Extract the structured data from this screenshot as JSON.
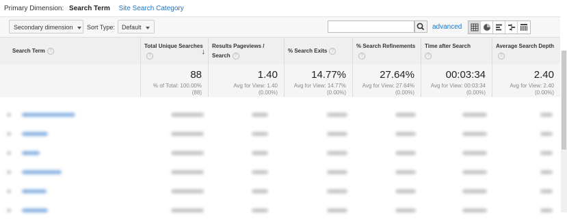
{
  "primary_dimension": {
    "label": "Primary Dimension:",
    "selected": "Search Term",
    "other": "Site Search Category"
  },
  "toolbar": {
    "secondary_dimension": "Secondary dimension",
    "sort_type_label": "Sort Type:",
    "sort_type_value": "Default",
    "search_value": "",
    "advanced": "advanced",
    "view_icons": [
      "table-view-icon",
      "pie-view-icon",
      "bar-view-icon",
      "comparison-view-icon",
      "pivot-view-icon"
    ]
  },
  "columns": [
    {
      "label": "Search Term"
    },
    {
      "label": "Total Unique Searches"
    },
    {
      "label": "Results Pageviews / Search"
    },
    {
      "label": "% Search Exits"
    },
    {
      "label": "% Search Refinements"
    },
    {
      "label": "Time after Search"
    },
    {
      "label": "Average Search Depth"
    }
  ],
  "totals": [
    {
      "value": "88",
      "sub1": "% of Total: 100.00%",
      "sub2": "(88)"
    },
    {
      "value": "1.40",
      "sub1": "Avg for View: 1.40",
      "sub2": "(0.00%)"
    },
    {
      "value": "14.77%",
      "sub1": "Avg for View: 14.77%",
      "sub2": "(0.00%)"
    },
    {
      "value": "27.64%",
      "sub1": "Avg for View: 27.64%",
      "sub2": "(0.00%)"
    },
    {
      "value": "00:03:34",
      "sub1": "Avg for View: 00:03:34",
      "sub2": "(0.00%)"
    },
    {
      "value": "2.40",
      "sub1": "Avg for View: 2.40",
      "sub2": "(0.00%)"
    }
  ],
  "colors": {
    "link": "#1a73c8",
    "header_bg": "#efefef",
    "totals_bg": "#f5f5f5",
    "blurred_text": "#c5c5c5",
    "blurred_link": "#8fb6e2"
  }
}
